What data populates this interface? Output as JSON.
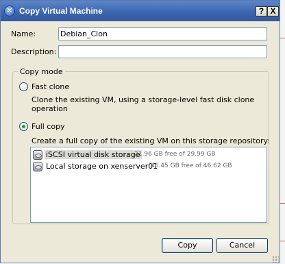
{
  "window": {
    "title": "Copy Virtual Machine",
    "help_button": "?",
    "close_button": "X"
  },
  "form": {
    "name_label": "Name:",
    "name_value": "Debian_Clon",
    "description_label": "Description:",
    "description_value": ""
  },
  "copy_mode": {
    "group_label": "Copy mode",
    "fast_clone": {
      "label": "Fast clone",
      "description": "Clone the existing VM, using a storage-level fast disk clone operation",
      "selected": false
    },
    "full_copy": {
      "label": "Full copy",
      "description": "Create a full copy of the existing VM on this storage repository:",
      "selected": true
    }
  },
  "storage_repositories": [
    {
      "name": "iSCSI virtual disk storage",
      "free": "21.96 GB free of 29.99 GB",
      "selected": true
    },
    {
      "name": "Local storage on xenserver01",
      "free": "46.45 GB free of 46.62 GB",
      "selected": false
    }
  ],
  "buttons": {
    "copy": "Copy",
    "cancel": "Cancel"
  },
  "colors": {
    "titlebar": "#3a64ae",
    "dialog_bg": "#ece9d8",
    "radio_dot": "#21a121"
  }
}
